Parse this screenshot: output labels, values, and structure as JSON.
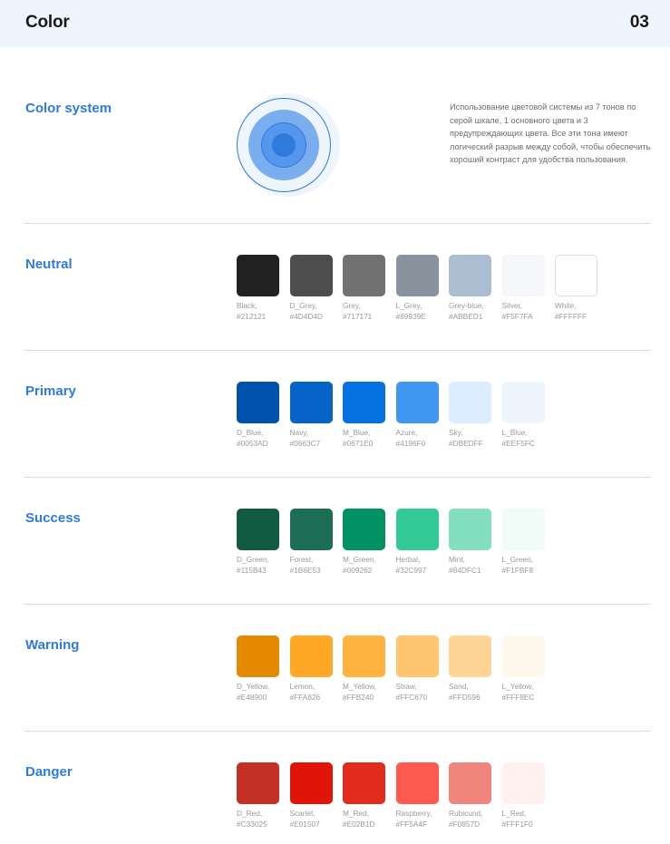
{
  "header": {
    "title": "Color",
    "page_number": "03"
  },
  "color_system": {
    "title": "Color system",
    "description": "Использование цветовой системы из 7 тонов по серой шкале, 1 основного цвета и 3 предупреждающих цвета. Все эти тона имеют логический разрыв между собой, чтобы обеспечить хороший контраст для удобства пользования.",
    "rings": [
      "#EEF5FC",
      "#2F7BDB",
      "#7AAEEF",
      "#5596EE",
      "#2F7BDB"
    ]
  },
  "palettes": [
    {
      "title": "Neutral",
      "swatches": [
        {
          "name": "Black,",
          "hex": "#212121"
        },
        {
          "name": "D_Grey,",
          "hex": "#4D4D4D"
        },
        {
          "name": "Grey,",
          "hex": "#717171"
        },
        {
          "name": "L_Grey,",
          "hex": "#89939E"
        },
        {
          "name": "Grey-blue,",
          "hex": "#ABBED1"
        },
        {
          "name": "Silver,",
          "hex": "#F5F7FA"
        },
        {
          "name": "White,",
          "hex": "#FFFFFF"
        }
      ]
    },
    {
      "title": "Primary",
      "swatches": [
        {
          "name": "D_Blue,",
          "hex": "#0053AD"
        },
        {
          "name": "Navy,",
          "hex": "#0663C7"
        },
        {
          "name": "M_Blue,",
          "hex": "#0671E0"
        },
        {
          "name": "Azure,",
          "hex": "#4196F0"
        },
        {
          "name": "Sky,",
          "hex": "#DBEDFF"
        },
        {
          "name": "L_Blue,",
          "hex": "#EEF5FC"
        }
      ]
    },
    {
      "title": "Success",
      "swatches": [
        {
          "name": "D_Green,",
          "hex": "#115B43"
        },
        {
          "name": "Forest,",
          "hex": "#1B6E53"
        },
        {
          "name": "M_Green,",
          "hex": "#009262"
        },
        {
          "name": "Herbal,",
          "hex": "#32C997"
        },
        {
          "name": "Mint,",
          "hex": "#84DFC1"
        },
        {
          "name": "L_Green,",
          "hex": "#F1FBF8"
        }
      ]
    },
    {
      "title": "Warning",
      "swatches": [
        {
          "name": "D_Yellow,",
          "hex": "#E48900"
        },
        {
          "name": "Lemon,",
          "hex": "#FFA826"
        },
        {
          "name": "M_Yellow,",
          "hex": "#FFB240"
        },
        {
          "name": "Straw,",
          "hex": "#FFC670"
        },
        {
          "name": "Sand,",
          "hex": "#FFD596"
        },
        {
          "name": "L_Yellow,",
          "hex": "#FFF8EC"
        }
      ]
    },
    {
      "title": "Danger",
      "swatches": [
        {
          "name": "D_Red,",
          "hex": "#C33025"
        },
        {
          "name": "Scarlet,",
          "hex": "#E01507"
        },
        {
          "name": "M_Red,",
          "hex": "#E02B1D"
        },
        {
          "name": "Raspberry,",
          "hex": "#FF5A4F"
        },
        {
          "name": "Rubicund,",
          "hex": "#F0857D"
        },
        {
          "name": "L_Red,",
          "hex": "#FFF1F0"
        }
      ]
    }
  ]
}
